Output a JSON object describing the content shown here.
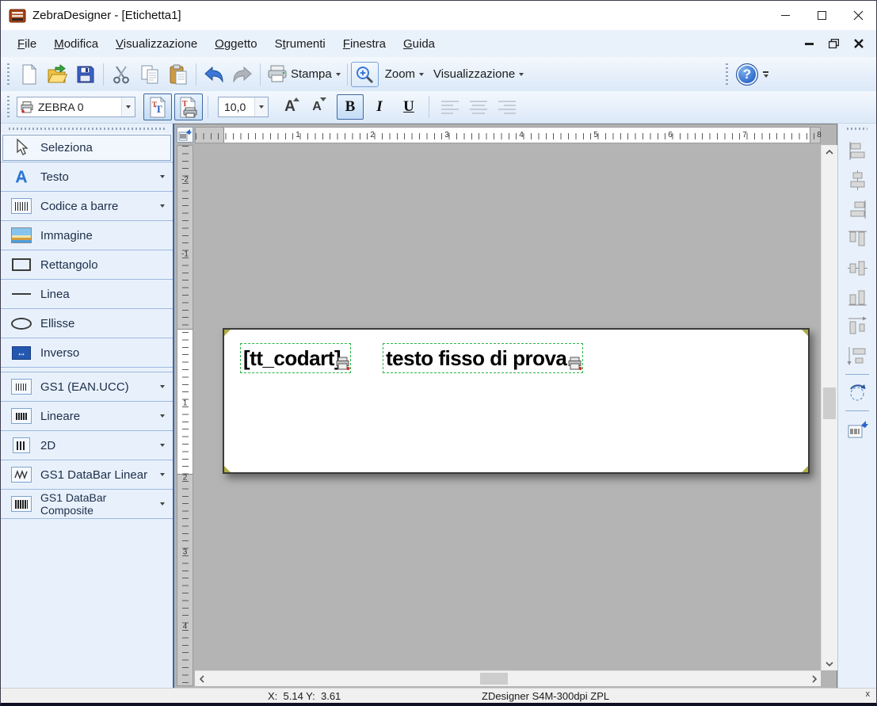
{
  "window": {
    "title": "ZebraDesigner - [Etichetta1]"
  },
  "menu": {
    "items": [
      {
        "label": "File",
        "u": 0
      },
      {
        "label": "Modifica",
        "u": 0
      },
      {
        "label": "Visualizzazione",
        "u": 0
      },
      {
        "label": "Oggetto",
        "u": 0
      },
      {
        "label": "Strumenti",
        "u": 1
      },
      {
        "label": "Finestra",
        "u": 0
      },
      {
        "label": "Guida",
        "u": 0
      }
    ]
  },
  "toolbar_main": {
    "print_label": "Stampa",
    "zoom_label": "Zoom",
    "view_label": "Visualizzazione"
  },
  "toolbar_format": {
    "printer_name": "ZEBRA 0",
    "font_size": "10,0",
    "increase_font_label": "A",
    "decrease_font_label": "A",
    "bold_label": "B",
    "italic_label": "I",
    "underline_label": "U"
  },
  "toolbox": {
    "items": [
      {
        "label": "Seleziona"
      },
      {
        "label": "Testo"
      },
      {
        "label": "Codice a barre"
      },
      {
        "label": "Immagine"
      },
      {
        "label": "Rettangolo"
      },
      {
        "label": "Linea"
      },
      {
        "label": "Ellisse"
      },
      {
        "label": "Inverso"
      },
      {
        "label": "GS1 (EAN.UCC)"
      },
      {
        "label": "Lineare"
      },
      {
        "label": "2D"
      },
      {
        "label": "GS1 DataBar Linear"
      },
      {
        "label": "GS1 DataBar Composite"
      }
    ]
  },
  "rulers": {
    "horizontal": [
      "1",
      "2",
      "3",
      "4",
      "5",
      "6",
      "7",
      "8"
    ],
    "vertical": [
      "-2",
      "-1",
      "1",
      "2",
      "3",
      "4"
    ]
  },
  "label_objects": [
    {
      "text": "[tt_codart]"
    },
    {
      "text": "testo fisso di prova"
    }
  ],
  "statusbar": {
    "coordinates": "X:  5.14 Y:  3.61",
    "printer": "ZDesigner S4M-300dpi ZPL",
    "close_label": "x"
  },
  "colors": {
    "selection_green": "#2db44a",
    "accent_blue": "#2f6fce",
    "canvas_gray": "#b4b4b4",
    "toolbar_blue": "#e8f1fb"
  }
}
